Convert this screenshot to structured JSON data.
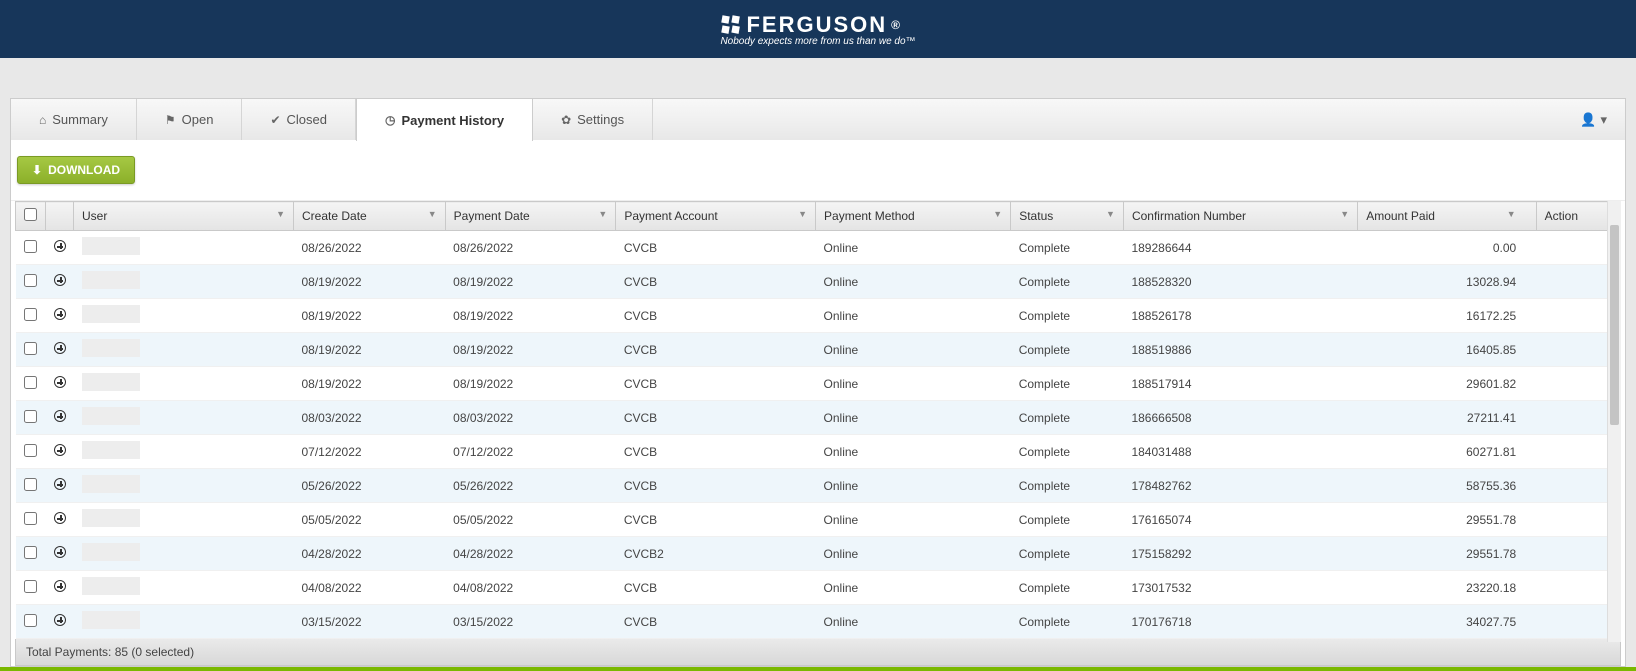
{
  "brand": {
    "name": "FERGUSON",
    "tagline": "Nobody expects more from us than we do™"
  },
  "tabs": {
    "summary": "Summary",
    "open": "Open",
    "closed": "Closed",
    "payment_history": "Payment History",
    "settings": "Settings"
  },
  "toolbar": {
    "download": "DOWNLOAD"
  },
  "columns": {
    "user": "User",
    "create_date": "Create Date",
    "payment_date": "Payment Date",
    "payment_account": "Payment Account",
    "payment_method": "Payment Method",
    "status": "Status",
    "confirmation": "Confirmation Number",
    "amount_paid": "Amount Paid",
    "action": "Action"
  },
  "rows": [
    {
      "create_date": "08/26/2022",
      "payment_date": "08/26/2022",
      "account": "CVCB",
      "method": "Online",
      "status": "Complete",
      "confirmation": "189286644",
      "amount": "0.00"
    },
    {
      "create_date": "08/19/2022",
      "payment_date": "08/19/2022",
      "account": "CVCB",
      "method": "Online",
      "status": "Complete",
      "confirmation": "188528320",
      "amount": "13028.94"
    },
    {
      "create_date": "08/19/2022",
      "payment_date": "08/19/2022",
      "account": "CVCB",
      "method": "Online",
      "status": "Complete",
      "confirmation": "188526178",
      "amount": "16172.25"
    },
    {
      "create_date": "08/19/2022",
      "payment_date": "08/19/2022",
      "account": "CVCB",
      "method": "Online",
      "status": "Complete",
      "confirmation": "188519886",
      "amount": "16405.85"
    },
    {
      "create_date": "08/19/2022",
      "payment_date": "08/19/2022",
      "account": "CVCB",
      "method": "Online",
      "status": "Complete",
      "confirmation": "188517914",
      "amount": "29601.82"
    },
    {
      "create_date": "08/03/2022",
      "payment_date": "08/03/2022",
      "account": "CVCB",
      "method": "Online",
      "status": "Complete",
      "confirmation": "186666508",
      "amount": "27211.41"
    },
    {
      "create_date": "07/12/2022",
      "payment_date": "07/12/2022",
      "account": "CVCB",
      "method": "Online",
      "status": "Complete",
      "confirmation": "184031488",
      "amount": "60271.81"
    },
    {
      "create_date": "05/26/2022",
      "payment_date": "05/26/2022",
      "account": "CVCB",
      "method": "Online",
      "status": "Complete",
      "confirmation": "178482762",
      "amount": "58755.36"
    },
    {
      "create_date": "05/05/2022",
      "payment_date": "05/05/2022",
      "account": "CVCB",
      "method": "Online",
      "status": "Complete",
      "confirmation": "176165074",
      "amount": "29551.78"
    },
    {
      "create_date": "04/28/2022",
      "payment_date": "04/28/2022",
      "account": "CVCB2",
      "method": "Online",
      "status": "Complete",
      "confirmation": "175158292",
      "amount": "29551.78"
    },
    {
      "create_date": "04/08/2022",
      "payment_date": "04/08/2022",
      "account": "CVCB",
      "method": "Online",
      "status": "Complete",
      "confirmation": "173017532",
      "amount": "23220.18"
    },
    {
      "create_date": "03/15/2022",
      "payment_date": "03/15/2022",
      "account": "CVCB",
      "method": "Online",
      "status": "Complete",
      "confirmation": "170176718",
      "amount": "34027.75"
    }
  ],
  "footer": {
    "summary": "Total Payments: 85 (0 selected)"
  }
}
